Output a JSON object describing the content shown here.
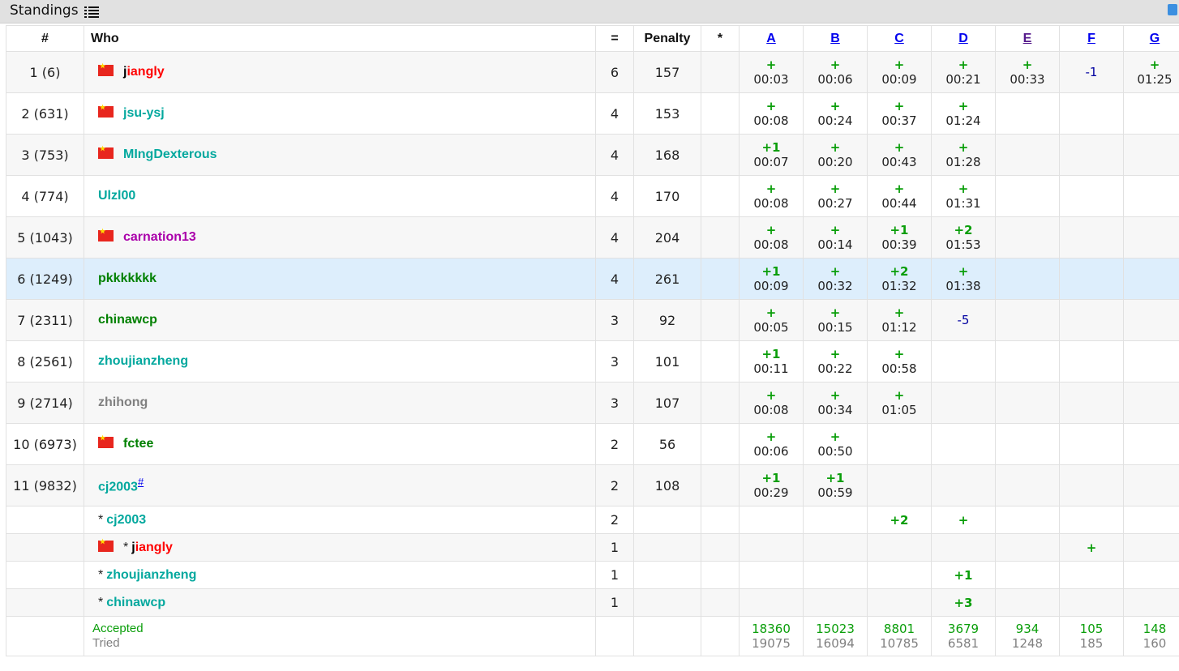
{
  "header": {
    "title": "Standings"
  },
  "columns": {
    "rank": "#",
    "who": "Who",
    "solved": "=",
    "penalty": "Penalty",
    "hacks": "*"
  },
  "problems": [
    "A",
    "B",
    "C",
    "D",
    "E",
    "F",
    "G"
  ],
  "rows": [
    {
      "rank": "1 (6)",
      "flag": true,
      "name_first": "j",
      "name_rest": "iangly",
      "color": "red",
      "solved": "6",
      "penalty": "157",
      "cells": [
        {
          "res": "+",
          "time": "00:03"
        },
        {
          "res": "+",
          "time": "00:06"
        },
        {
          "res": "+",
          "time": "00:09"
        },
        {
          "res": "+",
          "time": "00:21"
        },
        {
          "res": "+",
          "time": "00:33"
        },
        {
          "rej": "-1"
        },
        {
          "res": "+",
          "time": "01:25"
        }
      ]
    },
    {
      "rank": "2 (631)",
      "flag": true,
      "name": "jsu-ysj",
      "color": "teal",
      "solved": "4",
      "penalty": "153",
      "cells": [
        {
          "res": "+",
          "time": "00:08"
        },
        {
          "res": "+",
          "time": "00:24"
        },
        {
          "res": "+",
          "time": "00:37"
        },
        {
          "res": "+",
          "time": "01:24"
        },
        {},
        {},
        {}
      ]
    },
    {
      "rank": "3 (753)",
      "flag": true,
      "name": "MIngDexterous",
      "color": "teal",
      "solved": "4",
      "penalty": "168",
      "cells": [
        {
          "res": "+1",
          "time": "00:07"
        },
        {
          "res": "+",
          "time": "00:20"
        },
        {
          "res": "+",
          "time": "00:43"
        },
        {
          "res": "+",
          "time": "01:28"
        },
        {},
        {},
        {}
      ]
    },
    {
      "rank": "4 (774)",
      "flag": false,
      "name": "Ulzl00",
      "color": "teal",
      "solved": "4",
      "penalty": "170",
      "cells": [
        {
          "res": "+",
          "time": "00:08"
        },
        {
          "res": "+",
          "time": "00:27"
        },
        {
          "res": "+",
          "time": "00:44"
        },
        {
          "res": "+",
          "time": "01:31"
        },
        {},
        {},
        {}
      ]
    },
    {
      "rank": "5 (1043)",
      "flag": true,
      "name": "carnation13",
      "color": "purple",
      "solved": "4",
      "penalty": "204",
      "cells": [
        {
          "res": "+",
          "time": "00:08"
        },
        {
          "res": "+",
          "time": "00:14"
        },
        {
          "res": "+1",
          "time": "00:39"
        },
        {
          "res": "+2",
          "time": "01:53"
        },
        {},
        {},
        {}
      ]
    },
    {
      "rank": "6 (1249)",
      "flag": false,
      "name": "pkkkkkkk",
      "color": "green",
      "solved": "4",
      "penalty": "261",
      "cells": [
        {
          "res": "+1",
          "time": "00:09"
        },
        {
          "res": "+",
          "time": "00:32"
        },
        {
          "res": "+2",
          "time": "01:32"
        },
        {
          "res": "+",
          "time": "01:38"
        },
        {},
        {},
        {}
      ]
    },
    {
      "rank": "7 (2311)",
      "flag": false,
      "name": "chinawcp",
      "color": "green",
      "solved": "3",
      "penalty": "92",
      "cells": [
        {
          "res": "+",
          "time": "00:05"
        },
        {
          "res": "+",
          "time": "00:15"
        },
        {
          "res": "+",
          "time": "01:12"
        },
        {
          "rej": "-5"
        },
        {},
        {},
        {}
      ]
    },
    {
      "rank": "8 (2561)",
      "flag": false,
      "name": "zhoujianzheng",
      "color": "teal",
      "solved": "3",
      "penalty": "101",
      "cells": [
        {
          "res": "+1",
          "time": "00:11"
        },
        {
          "res": "+",
          "time": "00:22"
        },
        {
          "res": "+",
          "time": "00:58"
        },
        {},
        {},
        {},
        {}
      ]
    },
    {
      "rank": "9 (2714)",
      "flag": false,
      "name": "zhihong",
      "color": "gray",
      "solved": "3",
      "penalty": "107",
      "cells": [
        {
          "res": "+",
          "time": "00:08"
        },
        {
          "res": "+",
          "time": "00:34"
        },
        {
          "res": "+",
          "time": "01:05"
        },
        {},
        {},
        {},
        {}
      ]
    },
    {
      "rank": "10 (6973)",
      "flag": true,
      "name": "fctee",
      "color": "green",
      "solved": "2",
      "penalty": "56",
      "cells": [
        {
          "res": "+",
          "time": "00:06"
        },
        {
          "res": "+",
          "time": "00:50"
        },
        {},
        {},
        {},
        {},
        {}
      ]
    },
    {
      "rank": "11 (9832)",
      "flag": false,
      "name": "cj2003",
      "hash": "#",
      "color": "teal",
      "solved": "2",
      "penalty": "108",
      "cells": [
        {
          "res": "+1",
          "time": "00:29"
        },
        {
          "res": "+1",
          "time": "00:59"
        },
        {},
        {},
        {},
        {},
        {}
      ]
    }
  ],
  "unofficial": [
    {
      "flag": false,
      "star": "*",
      "name": "cj2003",
      "color": "teal",
      "solved": "2",
      "cells": [
        {},
        {},
        {
          "res": "+2"
        },
        {
          "res": "+"
        },
        {},
        {},
        {}
      ]
    },
    {
      "flag": true,
      "star": "*",
      "name_first": "j",
      "name_rest": "iangly",
      "color": "red",
      "solved": "1",
      "cells": [
        {},
        {},
        {},
        {},
        {},
        {
          "res": "+"
        },
        {}
      ]
    },
    {
      "flag": false,
      "star": "*",
      "name": "zhoujianzheng",
      "color": "teal",
      "solved": "1",
      "cells": [
        {},
        {},
        {},
        {
          "res": "+1"
        },
        {},
        {},
        {}
      ]
    },
    {
      "flag": false,
      "star": "*",
      "name": "chinawcp",
      "color": "teal",
      "solved": "1",
      "cells": [
        {},
        {},
        {},
        {
          "res": "+3"
        },
        {},
        {},
        {}
      ]
    }
  ],
  "stats": {
    "accepted_label": "Accepted",
    "tried_label": "Tried",
    "accepted": [
      "18360",
      "15023",
      "8801",
      "3679",
      "934",
      "105",
      "148"
    ],
    "tried": [
      "19075",
      "16094",
      "10785",
      "6581",
      "1248",
      "185",
      "160"
    ]
  }
}
